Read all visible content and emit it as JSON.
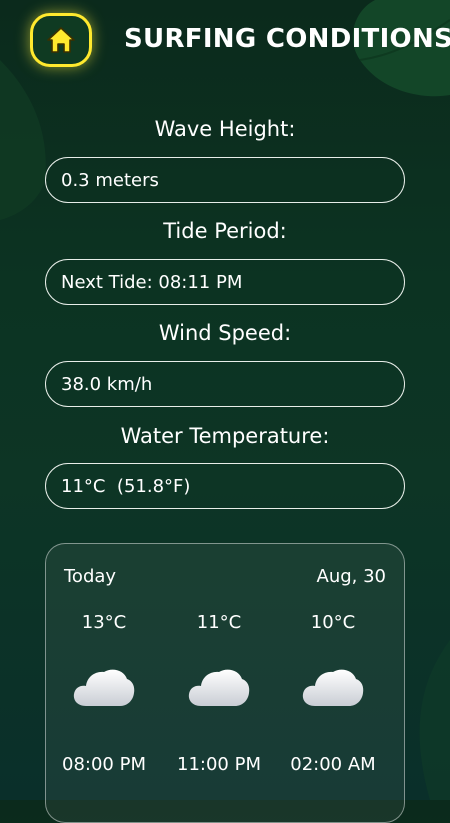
{
  "header": {
    "home_icon": "home-icon",
    "title": "SURFING CONDITIONS"
  },
  "fields": [
    {
      "label": "Wave Height:",
      "value": "0.3 meters"
    },
    {
      "label": "Tide Period:",
      "value": "Next Tide: 08:11 PM"
    },
    {
      "label": "Wind Speed:",
      "value": "38.0 km/h"
    },
    {
      "label": "Water Temperature:",
      "value": "11°C  (51.8°F)"
    }
  ],
  "forecast": {
    "day_label": "Today",
    "date_label": "Aug, 30",
    "items": [
      {
        "temp": "13°C",
        "icon": "cloud-icon",
        "time": "08:00 PM"
      },
      {
        "temp": "11°C",
        "icon": "cloud-icon",
        "time": "11:00 PM"
      },
      {
        "temp": "10°C",
        "icon": "cloud-icon",
        "time": "02:00 AM"
      }
    ]
  },
  "colors": {
    "accent": "#ffe92e",
    "background": "#0c3322"
  }
}
